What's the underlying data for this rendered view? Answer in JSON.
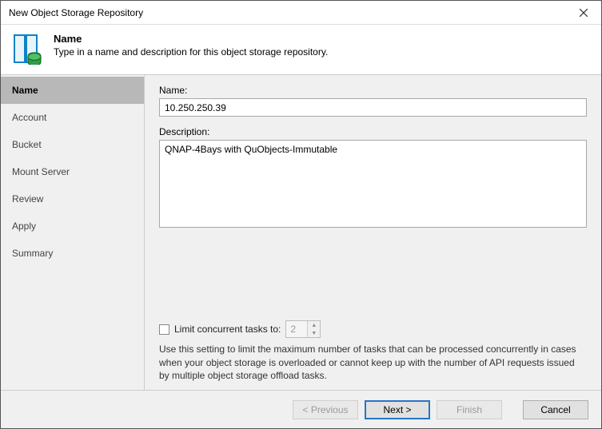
{
  "window": {
    "title": "New Object Storage Repository"
  },
  "header": {
    "title": "Name",
    "subtitle": "Type in a name and description for this object storage repository."
  },
  "sidebar": {
    "items": [
      {
        "label": "Name",
        "active": true
      },
      {
        "label": "Account",
        "active": false
      },
      {
        "label": "Bucket",
        "active": false
      },
      {
        "label": "Mount Server",
        "active": false
      },
      {
        "label": "Review",
        "active": false
      },
      {
        "label": "Apply",
        "active": false
      },
      {
        "label": "Summary",
        "active": false
      }
    ]
  },
  "form": {
    "name_label": "Name:",
    "name_value": "10.250.250.39",
    "description_label": "Description:",
    "description_value": "QNAP-4Bays with QuObjects-Immutable",
    "limit_checkbox_label": "Limit concurrent tasks to:",
    "limit_value": "2",
    "limit_help": "Use this setting to limit the maximum number of tasks that can be processed concurrently in cases when your object storage is overloaded or cannot keep up with the number of API requests issued by multiple object storage offload tasks."
  },
  "footer": {
    "previous": "< Previous",
    "next": "Next >",
    "finish": "Finish",
    "cancel": "Cancel"
  }
}
